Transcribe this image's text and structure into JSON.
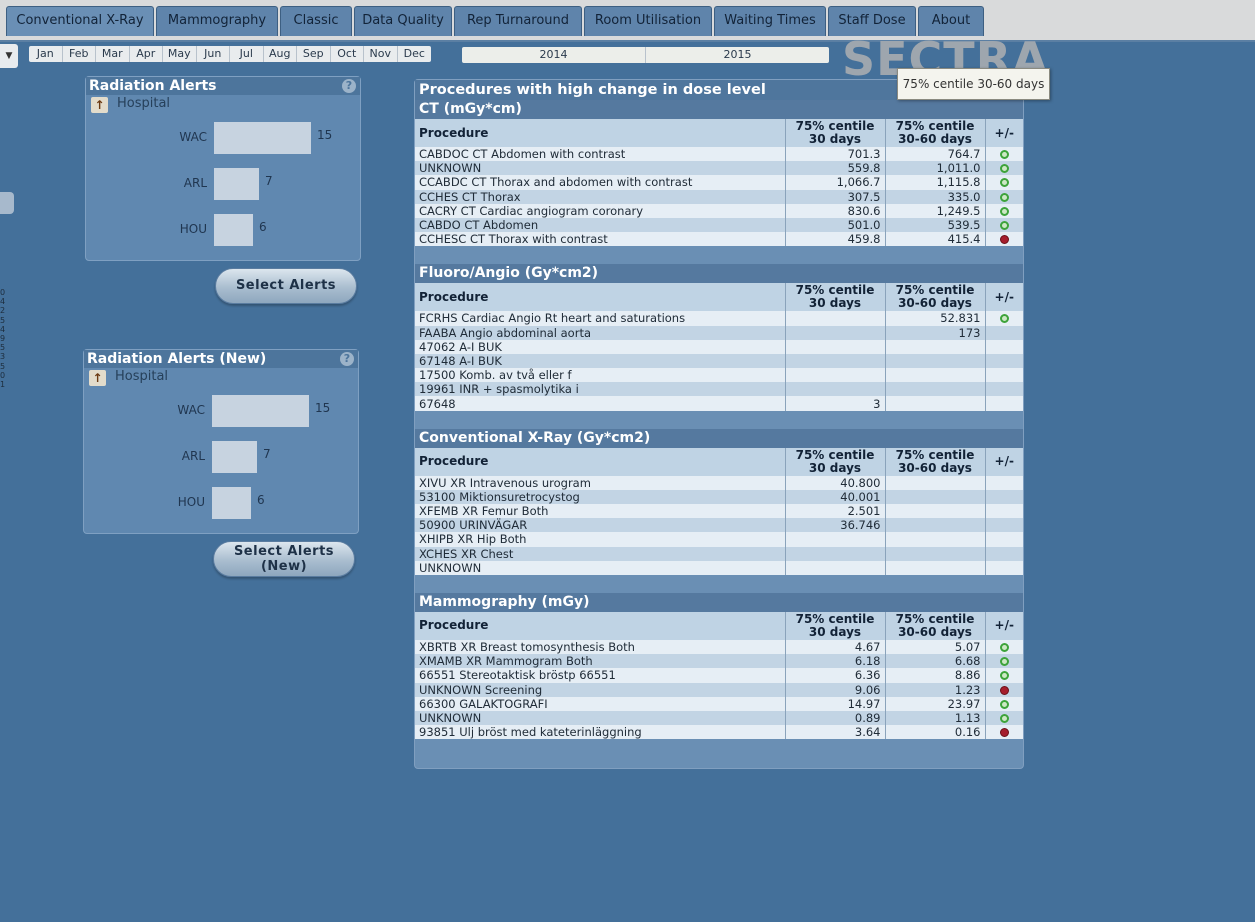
{
  "tabs": [
    {
      "label": "Conventional X-Ray",
      "active": true
    },
    {
      "label": "Mammography"
    },
    {
      "label": "Classic"
    },
    {
      "label": "Data Quality"
    },
    {
      "label": "Rep Turnaround"
    },
    {
      "label": "Room Utilisation"
    },
    {
      "label": "Waiting Times"
    },
    {
      "label": "Staff Dose"
    },
    {
      "label": "About"
    }
  ],
  "filters": {
    "dropdown_icon": "chevron-down-icon",
    "months": [
      "Jan",
      "Feb",
      "Mar",
      "Apr",
      "May",
      "Jun",
      "Jul",
      "Aug",
      "Sep",
      "Oct",
      "Nov",
      "Dec"
    ],
    "years": [
      "2014",
      "2015"
    ]
  },
  "logo": "SECTRA",
  "tooltip": "75% centile 30-60 days",
  "left_edge_numbers": [
    "0",
    "4",
    "2",
    "5",
    "4",
    "9",
    "5",
    "3",
    "5",
    "0",
    "1"
  ],
  "alerts": [
    {
      "title": "Radiation Alerts",
      "level": "Hospital",
      "max": 15,
      "rows": [
        {
          "label": "WAC",
          "value": 15
        },
        {
          "label": "ARL",
          "value": 7
        },
        {
          "label": "HOU",
          "value": 6
        }
      ],
      "button_line1": "Select Alerts",
      "button_line2": ""
    },
    {
      "title": "Radiation Alerts (New)",
      "level": "Hospital",
      "max": 15,
      "rows": [
        {
          "label": "WAC",
          "value": 15
        },
        {
          "label": "ARL",
          "value": 7
        },
        {
          "label": "HOU",
          "value": 6
        }
      ],
      "button_line1": "Select Alerts",
      "button_line2": "(New)"
    }
  ],
  "procedures": {
    "title": "Procedures with high change in dose level",
    "columns": {
      "procedure": "Procedure",
      "c30_line1": "75% centile",
      "c30_line2": "30 days",
      "c60_line1": "75% centile",
      "c60_line2": "30-60 days",
      "change": "+/-"
    },
    "status_colors": {
      "up": "#3da33a",
      "down": "#a51d2d"
    },
    "sections": [
      {
        "title": "CT (mGy*cm)",
        "rows": [
          {
            "procedure": "CABDOC CT Abdomen with contrast",
            "c30": "701.3",
            "c60": "764.7",
            "status": "up"
          },
          {
            "procedure": "UNKNOWN",
            "c30": "559.8",
            "c60": "1,011.0",
            "status": "up"
          },
          {
            "procedure": "CCABDC CT Thorax and abdomen with contrast",
            "c30": "1,066.7",
            "c60": "1,115.8",
            "status": "up"
          },
          {
            "procedure": "CCHES CT Thorax",
            "c30": "307.5",
            "c60": "335.0",
            "status": "up"
          },
          {
            "procedure": "CACRY CT Cardiac angiogram coronary",
            "c30": "830.6",
            "c60": "1,249.5",
            "status": "up"
          },
          {
            "procedure": "CABDO CT Abdomen",
            "c30": "501.0",
            "c60": "539.5",
            "status": "up"
          },
          {
            "procedure": "CCHESC CT Thorax with contrast",
            "c30": "459.8",
            "c60": "415.4",
            "status": "down"
          }
        ]
      },
      {
        "title": "Fluoro/Angio (Gy*cm2)",
        "rows": [
          {
            "procedure": "FCRHS Cardiac Angio Rt heart and saturations",
            "c30": "",
            "c60": "52.831",
            "status": "up"
          },
          {
            "procedure": "FAABA Angio abdominal aorta",
            "c30": "",
            "c60": "173",
            "status": ""
          },
          {
            "procedure": "47062 A-I BUK",
            "c30": "",
            "c60": "",
            "status": ""
          },
          {
            "procedure": "67148 A-I BUK",
            "c30": "",
            "c60": "",
            "status": ""
          },
          {
            "procedure": "17500 Komb. av två eller f",
            "c30": "",
            "c60": "",
            "status": ""
          },
          {
            "procedure": "19961 INR + spasmolytika i",
            "c30": "",
            "c60": "",
            "status": ""
          },
          {
            "procedure": "67648",
            "c30": "3",
            "c60": "",
            "status": ""
          }
        ]
      },
      {
        "title": "Conventional X-Ray (Gy*cm2)",
        "rows": [
          {
            "procedure": "XIVU XR Intravenous urogram",
            "c30": "40.800",
            "c60": "",
            "status": ""
          },
          {
            "procedure": "53100 Miktionsuretrocystog",
            "c30": "40.001",
            "c60": "",
            "status": ""
          },
          {
            "procedure": "XFEMB XR Femur Both",
            "c30": "2.501",
            "c60": "",
            "status": ""
          },
          {
            "procedure": "50900 URINVÄGAR",
            "c30": "36.746",
            "c60": "",
            "status": ""
          },
          {
            "procedure": "XHIPB XR Hip Both",
            "c30": "",
            "c60": "",
            "status": ""
          },
          {
            "procedure": "XCHES XR Chest",
            "c30": "",
            "c60": "",
            "status": ""
          },
          {
            "procedure": "UNKNOWN",
            "c30": "",
            "c60": "",
            "status": ""
          }
        ]
      },
      {
        "title": "Mammography (mGy)",
        "rows": [
          {
            "procedure": "XBRTB XR Breast tomosynthesis Both",
            "c30": "4.67",
            "c60": "5.07",
            "status": "up"
          },
          {
            "procedure": "XMAMB XR Mammogram Both",
            "c30": "6.18",
            "c60": "6.68",
            "status": "up"
          },
          {
            "procedure": "66551 Stereotaktisk bröstp 66551",
            "c30": "6.36",
            "c60": "8.86",
            "status": "up"
          },
          {
            "procedure": "UNKNOWN Screening",
            "c30": "9.06",
            "c60": "1.23",
            "status": "down"
          },
          {
            "procedure": "66300 GALAKTOGRAFI",
            "c30": "14.97",
            "c60": "23.97",
            "status": "up"
          },
          {
            "procedure": "UNKNOWN",
            "c30": "0.89",
            "c60": "1.13",
            "status": "up"
          },
          {
            "procedure": "93851 Ulj bröst med kateterinläggning",
            "c30": "3.64",
            "c60": "0.16",
            "status": "down"
          }
        ]
      }
    ]
  }
}
